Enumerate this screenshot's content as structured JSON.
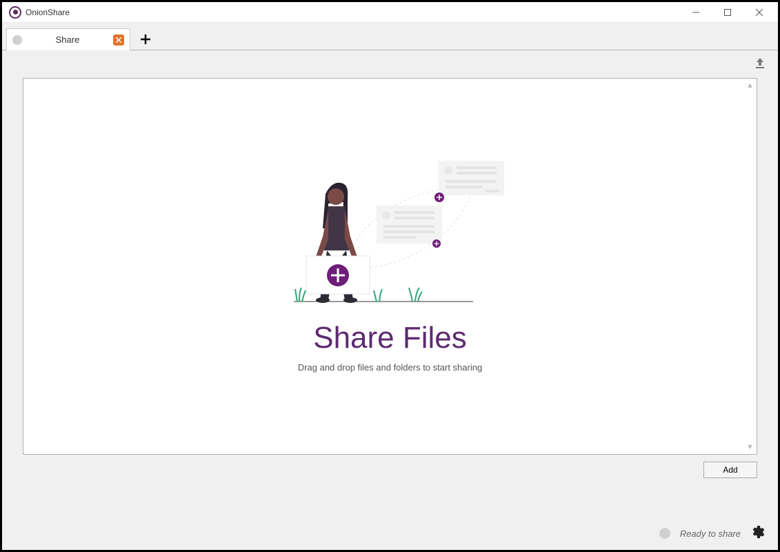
{
  "window": {
    "title": "OnionShare"
  },
  "tabs": [
    {
      "label": "Share"
    }
  ],
  "main": {
    "heading": "Share Files",
    "subtext": "Drag and drop files and folders to start sharing",
    "add_button": "Add"
  },
  "status": {
    "text": "Ready to share"
  }
}
